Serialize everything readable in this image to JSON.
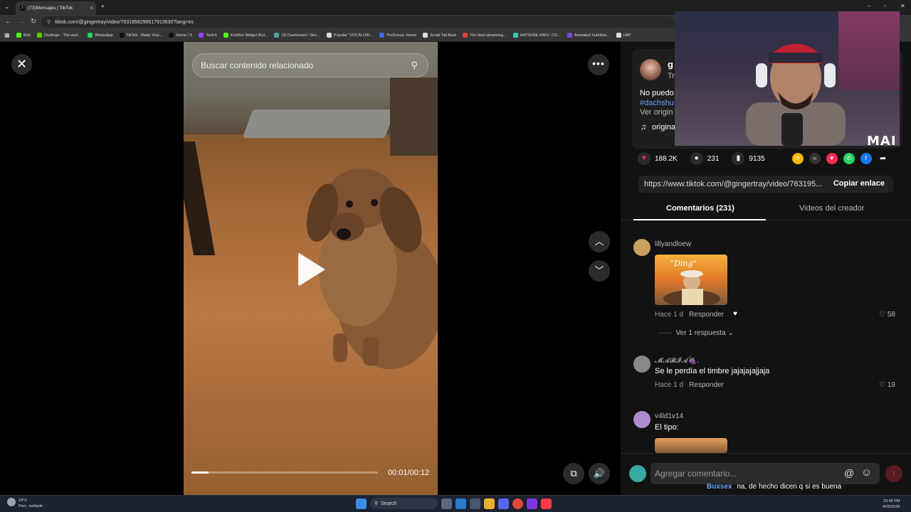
{
  "browser": {
    "tab_title": "(73)Mensajes | TikTok",
    "tab_close": "×",
    "new_tab": "+",
    "url": "tiktok.com/@gingertray/video/7631958296617913630?lang=es",
    "bookmarks": [
      {
        "label": "Kick",
        "color": "#53fc18"
      },
      {
        "label": "Duolingo - The worl...",
        "color": "#58cc02"
      },
      {
        "label": "WhatsApp",
        "color": "#25d366"
      },
      {
        "label": "TikTok - Make Your...",
        "color": "#111111"
      },
      {
        "label": "Home / X",
        "color": "#111111"
      },
      {
        "label": "Twitch",
        "color": "#9146ff"
      },
      {
        "label": "KickBot Widget Buil...",
        "color": "#53fc18"
      },
      {
        "label": "(3) Dashboard / Stre...",
        "color": "#3aa8a0"
      },
      {
        "label": "Popular \"VOCALOID...",
        "color": "#dddddd"
      },
      {
        "label": "PreSonus: Home",
        "color": "#3a6adf"
      },
      {
        "label": "Script Tail Beat",
        "color": "#dddddd"
      },
      {
        "label": "The best streaming...",
        "color": "#e04040"
      },
      {
        "label": "HATSUNE MIKU: CO...",
        "color": "#39c5bb"
      },
      {
        "label": "Animated Subtitles...",
        "color": "#7a4adf"
      },
      {
        "label": "HAT",
        "color": "#dddddd"
      }
    ]
  },
  "video": {
    "search_placeholder": "Buscar contenido relacionado",
    "timecode": "00:01/00:12",
    "progress": 0.09
  },
  "post": {
    "username_partial": "g",
    "subline_partial": "Tr",
    "caption_partial": "No puedo",
    "hashtag_partial": "#dachshu",
    "see_more_partial": "Ver origin",
    "sound_partial": "origina",
    "likes": "188.2K",
    "comments": "231",
    "saves": "9135",
    "link": "https://www.tiktok.com/@gingertray/video/763195...",
    "copy_link": "Copiar enlace"
  },
  "tabs": {
    "comments": "Comentarios (231)",
    "creator_videos": "Videos del creador"
  },
  "comments": [
    {
      "user": "lillyandloew",
      "text": "",
      "time": "Hace 1 d",
      "reply": "Responder",
      "likes": "58",
      "avatar_color": "#c8a060"
    },
    {
      "user": "𝓜𝓐𝓡𝓘𝓐🍇.",
      "text": "Se le perdía el timbre jajajajajjaja",
      "time": "Hace 1 d",
      "reply": "Responder",
      "likes": "19",
      "avatar_color": "#888888"
    },
    {
      "user": "v4ld1v14",
      "text": "El tipo:",
      "time": "",
      "reply": "",
      "likes": "",
      "avatar_color": "#b08ad0"
    }
  ],
  "replies_toggle": "Ver 1 respuesta",
  "comment_input_placeholder": "Agregar comentario...",
  "chat": {
    "user": "Buxsex",
    "message": "na, de hecho dicen q si es buena"
  },
  "webcam_logo": "MAI",
  "taskbar": {
    "weather_temp": "24°C",
    "weather_desc": "Parc. nublado",
    "search_label": "Search",
    "time": "10:46 PM",
    "date": "4/25/2026"
  }
}
